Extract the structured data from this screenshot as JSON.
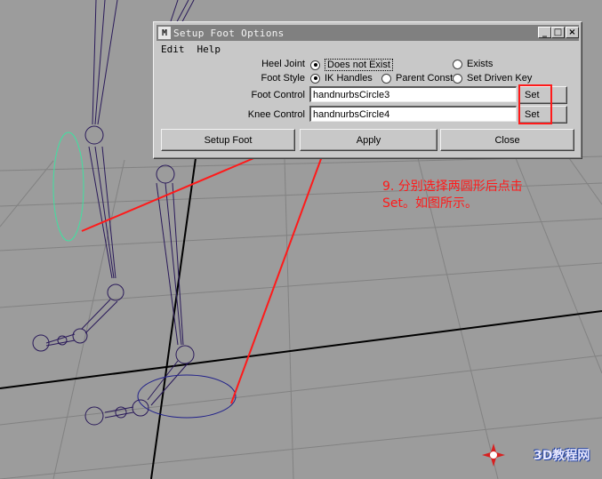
{
  "window": {
    "title": "Setup Foot Options",
    "icon_glyph": "M",
    "controls": {
      "minimize": "_",
      "maximize": "□",
      "close": "×"
    }
  },
  "menu": {
    "items": [
      "Edit",
      "Help"
    ]
  },
  "form": {
    "heel_joint": {
      "label": "Heel Joint",
      "options": [
        {
          "label": "Does not Exist",
          "selected": true
        },
        {
          "label": "Exists",
          "selected": false
        }
      ]
    },
    "foot_style": {
      "label": "Foot Style",
      "options": [
        {
          "label": "IK Handles",
          "selected": true
        },
        {
          "label": "Parent Const",
          "selected": false
        },
        {
          "label": "Set Driven Key",
          "selected": false
        }
      ]
    },
    "foot_control": {
      "label": "Foot Control",
      "value": "handnurbsCircle3",
      "set_label": "Set"
    },
    "knee_control": {
      "label": "Knee Control",
      "value": "handnurbsCircle4",
      "set_label": "Set"
    }
  },
  "buttons": {
    "setup": "Setup Foot",
    "apply": "Apply",
    "close": "Close"
  },
  "annotation": "9. 分别选择两圆形后点击\nSet。如图所示。",
  "watermark": "3D教程网",
  "colors": {
    "viewport_bg": "#9c9c9c",
    "grid": "#7e7e7e",
    "axis": "#000000",
    "skeleton": "#2a1a5a",
    "selected_curve": "#40e0a0",
    "foot_curve": "#20208a",
    "annotation_red": "#ff1a1a"
  }
}
